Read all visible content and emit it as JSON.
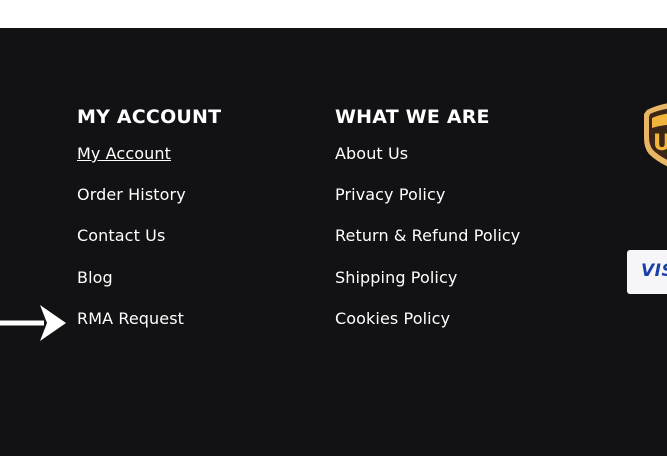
{
  "footer": {
    "my_account": {
      "heading": "MY ACCOUNT",
      "links": [
        "My Account",
        "Order History",
        "Contact Us",
        "Blog",
        "RMA Request"
      ]
    },
    "what_we_are": {
      "heading": "WHAT WE ARE",
      "links": [
        "About Us",
        "Privacy Policy",
        "Return & Refund Policy",
        "Shipping Policy",
        "Cookies Policy"
      ]
    },
    "badges": {
      "shipping_logo_text": "U",
      "payment_logo_text": "VISA"
    }
  },
  "colors": {
    "footer_bg": "#121214",
    "text": "#ffffff",
    "ups_brown": "#3b2516",
    "ups_gold": "#f2b43a",
    "visa_blue": "#1a3fa8"
  },
  "icons": {
    "pointer": "arrow-right-icon",
    "shipping": "ups-shield-icon",
    "payment": "visa-card-icon"
  }
}
